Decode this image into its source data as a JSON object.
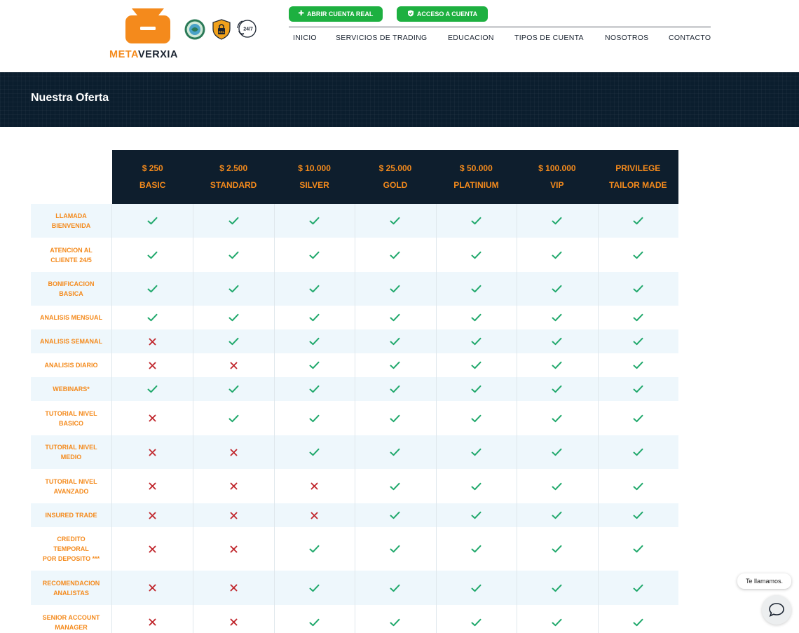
{
  "brand": {
    "name_part1": "META",
    "name_part2": "VERXIA",
    "orange": "#f48a1c",
    "dark": "#1a2330"
  },
  "header": {
    "open_account_label": "ABRIR CUENTA REAL",
    "access_account_label": "ACCESO A CUENTA",
    "badges": [
      "eco-seal-icon",
      "ssl-shield-icon",
      "support-24-7-icon"
    ],
    "support_badge_text": "24/7",
    "ssl_badge_text": "SSL",
    "nav": [
      "INICIO",
      "SERVICIOS DE TRADING",
      "EDUCACION",
      "TIPOS DE CUENTA",
      "NOSOTROS",
      "CONTACTO"
    ]
  },
  "banner": {
    "title": "Nuestra Oferta"
  },
  "plans": [
    {
      "price": "$ 250",
      "name": "BASIC"
    },
    {
      "price": "$ 2.500",
      "name": "STANDARD"
    },
    {
      "price": "$ 10.000",
      "name": "SILVER"
    },
    {
      "price": "$ 25.000",
      "name": "GOLD"
    },
    {
      "price": "$ 50.000",
      "name": "PLATINIUM"
    },
    {
      "price": "$ 100.000",
      "name": "VIP"
    },
    {
      "price": "PRIVILEGE",
      "name": "TAILOR MADE"
    }
  ],
  "features": [
    {
      "label": "LLAMADA\nBIENVENIDA",
      "values": [
        1,
        1,
        1,
        1,
        1,
        1,
        1
      ]
    },
    {
      "label": "ATENCION AL\nCLIENTE 24/5",
      "values": [
        1,
        1,
        1,
        1,
        1,
        1,
        1
      ]
    },
    {
      "label": "BONIFICACION\nBASICA",
      "values": [
        1,
        1,
        1,
        1,
        1,
        1,
        1
      ]
    },
    {
      "label": "ANALISIS MENSUAL",
      "values": [
        1,
        1,
        1,
        1,
        1,
        1,
        1
      ]
    },
    {
      "label": "ANALISIS SEMANAL",
      "values": [
        0,
        1,
        1,
        1,
        1,
        1,
        1
      ]
    },
    {
      "label": "ANALISIS DIARIO",
      "values": [
        0,
        0,
        1,
        1,
        1,
        1,
        1
      ]
    },
    {
      "label": "WEBINARS*",
      "values": [
        1,
        1,
        1,
        1,
        1,
        1,
        1
      ]
    },
    {
      "label": "TUTORIAL NIVEL\nBASICO",
      "values": [
        0,
        1,
        1,
        1,
        1,
        1,
        1
      ]
    },
    {
      "label": "TUTORIAL NIVEL\nMEDIO",
      "values": [
        0,
        0,
        1,
        1,
        1,
        1,
        1
      ]
    },
    {
      "label": "TUTORIAL NIVEL\nAVANZADO",
      "values": [
        0,
        0,
        0,
        1,
        1,
        1,
        1
      ]
    },
    {
      "label": "INSURED TRADE",
      "values": [
        0,
        0,
        0,
        1,
        1,
        1,
        1
      ]
    },
    {
      "label": "CREDITO\nTEMPORAL\nPOR DEPOSITO ***",
      "values": [
        0,
        0,
        1,
        1,
        1,
        1,
        1
      ]
    },
    {
      "label": "RECOMENDACION\nANALISTAS",
      "values": [
        0,
        0,
        1,
        1,
        1,
        1,
        1
      ]
    },
    {
      "label": "SENIOR ACCOUNT\nMANAGER",
      "values": [
        0,
        0,
        1,
        1,
        1,
        1,
        1
      ]
    }
  ],
  "colors": {
    "check": "#1fa86b",
    "cross": "#c0272d",
    "header_bg": "#0e1e2d",
    "banner_bg": "#0b1e2e",
    "alt_row": "#eef7fc",
    "button": "#1db040"
  },
  "chat": {
    "tooltip": "Te llamamos.",
    "icon": "chat-bubble-icon"
  }
}
